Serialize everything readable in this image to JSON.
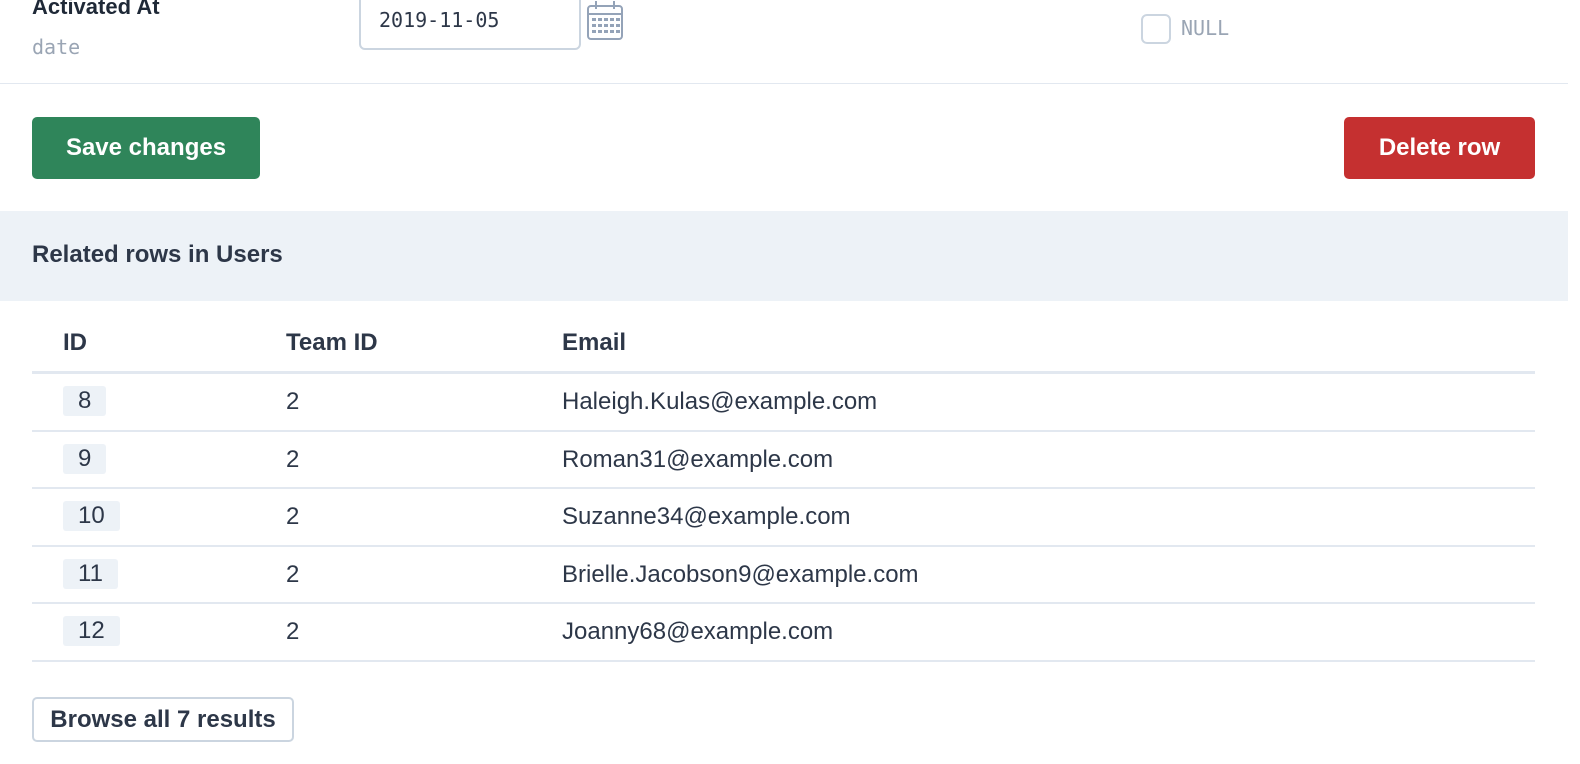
{
  "field": {
    "label": "Activated At",
    "type": "date",
    "value": "2019-11-05",
    "null_label": "NULL",
    "null_checked": false
  },
  "actions": {
    "save_label": "Save changes",
    "delete_label": "Delete row"
  },
  "related": {
    "title": "Related rows in Users",
    "columns": [
      "ID",
      "Team ID",
      "Email"
    ],
    "rows": [
      {
        "id": "8",
        "team_id": "2",
        "email": "Haleigh.Kulas@example.com"
      },
      {
        "id": "9",
        "team_id": "2",
        "email": "Roman31@example.com"
      },
      {
        "id": "10",
        "team_id": "2",
        "email": "Suzanne34@example.com"
      },
      {
        "id": "11",
        "team_id": "2",
        "email": "Brielle.Jacobson9@example.com"
      },
      {
        "id": "12",
        "team_id": "2",
        "email": "Joanny68@example.com"
      }
    ],
    "browse_label": "Browse all 7 results"
  },
  "icons": {
    "calendar": "calendar-icon"
  },
  "colors": {
    "save": "#2f855a",
    "delete": "#c53030",
    "section_bg": "#edf2f7"
  }
}
